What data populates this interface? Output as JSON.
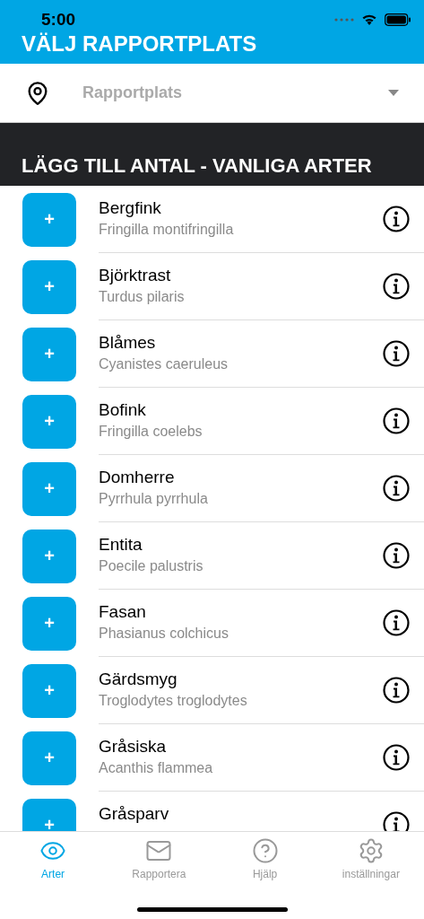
{
  "status_bar": {
    "time": "5:00"
  },
  "header": {
    "title": "VÄLJ RAPPORTPLATS"
  },
  "location_select": {
    "placeholder": "Rapportplats"
  },
  "section": {
    "title": "LÄGG TILL ANTAL - VANLIGA ARTER"
  },
  "species": [
    {
      "add": "+",
      "name": "Bergfink",
      "latin": "Fringilla montifringilla"
    },
    {
      "add": "+",
      "name": "Björktrast",
      "latin": "Turdus pilaris"
    },
    {
      "add": "+",
      "name": "Blåmes",
      "latin": "Cyanistes caeruleus"
    },
    {
      "add": "+",
      "name": "Bofink",
      "latin": "Fringilla coelebs"
    },
    {
      "add": "+",
      "name": "Domherre",
      "latin": "Pyrrhula pyrrhula"
    },
    {
      "add": "+",
      "name": "Entita",
      "latin": "Poecile palustris"
    },
    {
      "add": "+",
      "name": "Fasan",
      "latin": "Phasianus colchicus"
    },
    {
      "add": "+",
      "name": "Gärdsmyg",
      "latin": "Troglodytes troglodytes"
    },
    {
      "add": "+",
      "name": "Gråsiska",
      "latin": "Acanthis flammea"
    },
    {
      "add": "+",
      "name": "Gråsparv"
    }
  ],
  "tabs": [
    {
      "label": "Arter",
      "selected": true
    },
    {
      "label": "Rapportera",
      "selected": false
    },
    {
      "label": "Hjälp",
      "selected": false
    },
    {
      "label": "inställningar",
      "selected": false
    }
  ]
}
